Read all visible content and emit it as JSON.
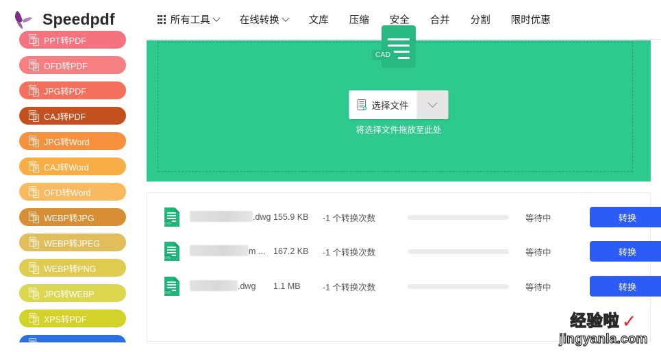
{
  "header": {
    "logo_text": "Speedpdf",
    "logo_icon": "butterfly-logo-icon",
    "nav": [
      {
        "label": "所有工具",
        "icon": "grid-icon",
        "has_caret": true
      },
      {
        "label": "在线转换",
        "icon": null,
        "has_caret": true
      },
      {
        "label": "文库",
        "icon": null,
        "has_caret": false
      },
      {
        "label": "压缩",
        "icon": null,
        "has_caret": false
      },
      {
        "label": "安全",
        "icon": null,
        "has_caret": false
      },
      {
        "label": "合并",
        "icon": null,
        "has_caret": false
      },
      {
        "label": "分割",
        "icon": null,
        "has_caret": false
      },
      {
        "label": "限时优惠",
        "icon": null,
        "has_caret": false
      }
    ]
  },
  "sidebar": {
    "items": [
      {
        "label": "PPT转PDF",
        "color": "#f4737f",
        "icon": "convert-file-icon",
        "active": false
      },
      {
        "label": "OFD转PDF",
        "color": "#f67f81",
        "icon": "convert-file-icon",
        "active": false
      },
      {
        "label": "JPG转PDF",
        "color": "#f5705c",
        "icon": "convert-file-icon",
        "active": false
      },
      {
        "label": "CAJ转PDF",
        "color": "#c4501f",
        "icon": "convert-file-icon",
        "active": true
      },
      {
        "label": "JPG转Word",
        "color": "#f7913e",
        "icon": "convert-file-icon",
        "active": false
      },
      {
        "label": "CAJ转Word",
        "color": "#f9ae45",
        "icon": "convert-file-icon",
        "active": false
      },
      {
        "label": "OFD转Word",
        "color": "#f9b95e",
        "icon": "convert-file-icon",
        "active": false
      },
      {
        "label": "WEBP转JPG",
        "color": "#d88e34",
        "icon": "convert-file-icon",
        "active": false
      },
      {
        "label": "WEBP转JPEG",
        "color": "#e2bd5b",
        "icon": "convert-file-icon",
        "active": false
      },
      {
        "label": "WEBP转PNG",
        "color": "#e0cb51",
        "icon": "convert-file-icon",
        "active": false
      },
      {
        "label": "JPG转WEBP",
        "color": "#dbd84f",
        "icon": "convert-file-icon",
        "active": false
      },
      {
        "label": "XPS转PDF",
        "color": "#d2d228",
        "icon": "convert-file-icon",
        "active": false
      },
      {
        "label": "",
        "color": "#2b6fe0",
        "icon": "convert-file-icon",
        "active": false
      }
    ]
  },
  "dropzone": {
    "doc_badge": "CAD",
    "doc_icon": "cad-document-icon",
    "select_button_label": "选择文件",
    "select_button_icon": "file-add-icon",
    "dropdown_icon": "chevron-down-icon",
    "drop_hint": "将选择文件拖放至此处",
    "background_color": "#2ec98f"
  },
  "filelist": {
    "rows": [
      {
        "icon": "cad-file-icon",
        "filename_suffix": ".dwg",
        "filename_redacted": true,
        "size": "155.9 KB",
        "count": "-1 个转换次数",
        "progress": 0,
        "status": "等待中",
        "action_label": "转换"
      },
      {
        "icon": "cad-file-icon",
        "filename_suffix": "m ...",
        "filename_redacted": true,
        "size": "167.2 KB",
        "count": "-1 个转换次数",
        "progress": 0,
        "status": "等待中",
        "action_label": "转换"
      },
      {
        "icon": "cad-file-icon",
        "filename_suffix": ".dwg",
        "filename_redacted": true,
        "size": "1.1 MB",
        "count": "-1 个转换次数",
        "progress": 0,
        "status": "等待中",
        "action_label": "转换"
      }
    ],
    "action_color": "#2b5cf6"
  },
  "watermark": {
    "chinese": "经验啦",
    "check": "✓",
    "domain": "jingyanla.com",
    "check_color": "#e8242a"
  }
}
